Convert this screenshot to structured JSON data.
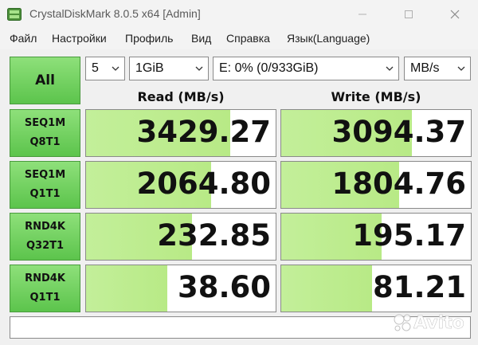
{
  "window": {
    "title": "CrystalDiskMark 8.0.5 x64 [Admin]"
  },
  "menu": [
    "Файл",
    "Настройки",
    "Профиль",
    "Вид",
    "Справка",
    "Язык(Language)"
  ],
  "controls": {
    "all_label": "All",
    "count": "5",
    "size": "1GiB",
    "drive": "E: 0% (0/933GiB)",
    "unit": "MB/s"
  },
  "columns": {
    "read": "Read (MB/s)",
    "write": "Write (MB/s)"
  },
  "tests": [
    {
      "line1": "SEQ1M",
      "line2": "Q8T1",
      "read": "3429.27",
      "write": "3094.37",
      "read_fill": 0.76,
      "write_fill": 0.69
    },
    {
      "line1": "SEQ1M",
      "line2": "Q1T1",
      "read": "2064.80",
      "write": "1804.76",
      "read_fill": 0.66,
      "write_fill": 0.62
    },
    {
      "line1": "RND4K",
      "line2": "Q32T1",
      "read": "232.85",
      "write": "195.17",
      "read_fill": 0.56,
      "write_fill": 0.53
    },
    {
      "line1": "RND4K",
      "line2": "Q1T1",
      "read": "38.60",
      "write": "81.21",
      "read_fill": 0.43,
      "write_fill": 0.48
    }
  ],
  "comment": "",
  "watermark": {
    "text": "Avito",
    "icon": "avito-logo-icon"
  },
  "colors": {
    "button_green": "#5cc44c",
    "bar_green": "#bdec8e"
  }
}
